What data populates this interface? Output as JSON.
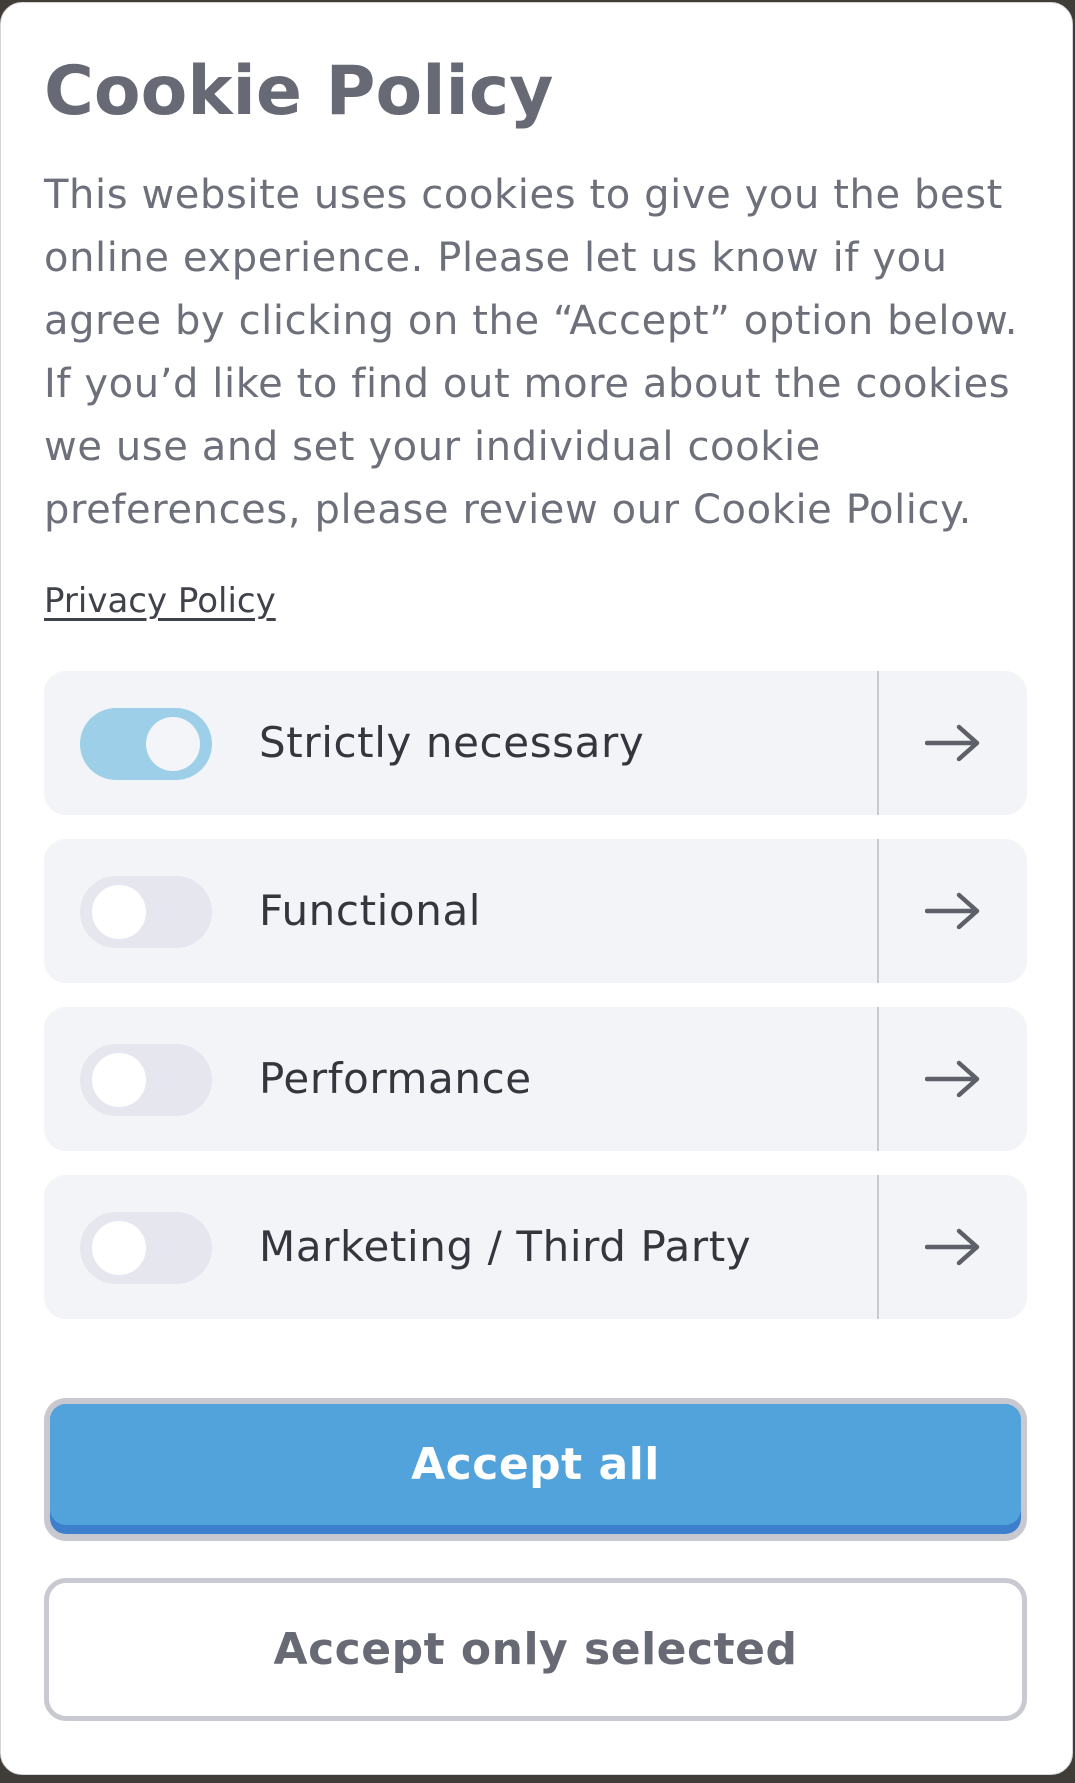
{
  "cookie_dialog": {
    "title": "Cookie Policy",
    "description": "This website uses cookies to give you the best online experience. Please let us know if you agree by clicking on the “Accept” option below. If you’d like to find out more about the cookies we use and set your individual cookie preferences, please review our Cookie Policy.",
    "privacy_link": "Privacy Policy",
    "categories": [
      {
        "label": "Strictly necessary",
        "enabled": true,
        "icon": "arrow-right-icon"
      },
      {
        "label": "Functional",
        "enabled": false,
        "icon": "arrow-right-icon"
      },
      {
        "label": "Performance",
        "enabled": false,
        "icon": "arrow-right-icon"
      },
      {
        "label": "Marketing / Third Party",
        "enabled": false,
        "icon": "arrow-right-icon"
      }
    ],
    "accept_all_label": "Accept all",
    "accept_selected_label": "Accept only selected"
  },
  "colors": {
    "accent": "#52a3db",
    "toggle_on": "#9ecfe9",
    "toggle_off": "#e6e7ee",
    "row_background": "#f3f4f8",
    "title_text": "#676a74"
  }
}
